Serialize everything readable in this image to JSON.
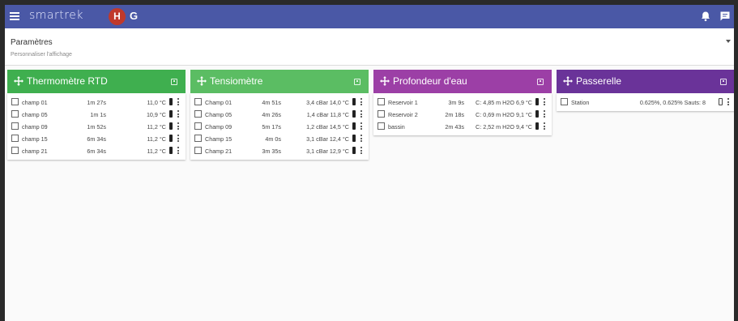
{
  "app": {
    "brand": "smartrek",
    "avatar_initial": "H",
    "avatar_letter": "G"
  },
  "params": {
    "title": "Paramètres",
    "subtitle": "Personnaliser l'affichage"
  },
  "colors": {
    "topbar": "#4a58a6",
    "avatar": "#c0392b",
    "thermo": "#3faf4f",
    "tensio": "#5bbd63",
    "profondeur": "#9c3fa6",
    "passerelle": "#6a3399"
  },
  "panels": [
    {
      "title": "Thermomètre RTD",
      "rows": [
        {
          "name": "champ 01",
          "time": "1m 27s",
          "value": "11,0 °C"
        },
        {
          "name": "champ 05",
          "time": "1m 1s",
          "value": "10,9 °C"
        },
        {
          "name": "champ 09",
          "time": "1m 52s",
          "value": "11,2 °C"
        },
        {
          "name": "champ 15",
          "time": "6m 34s",
          "value": "11,2 °C"
        },
        {
          "name": "champ 21",
          "time": "6m 34s",
          "value": "11,2 °C"
        }
      ]
    },
    {
      "title": "Tensiomètre",
      "rows": [
        {
          "name": "Champ 01",
          "time": "4m 51s",
          "value": "3,4 cBar 14,0 °C"
        },
        {
          "name": "Champ 05",
          "time": "4m 26s",
          "value": "1,4 cBar 11,8 °C"
        },
        {
          "name": "Champ 09",
          "time": "5m 17s",
          "value": "1,2 cBar 14,5 °C"
        },
        {
          "name": "Champ 15",
          "time": "4m 0s",
          "value": "3,1 cBar 12,4 °C"
        },
        {
          "name": "Champ 21",
          "time": "3m 35s",
          "value": "3,1 cBar 12,9 °C"
        }
      ]
    },
    {
      "title": "Profondeur d'eau",
      "rows": [
        {
          "name": "Reservoir 1",
          "time": "3m 9s",
          "value": "C: 4,85 m H2O 6,9 °C"
        },
        {
          "name": "Reservoir 2",
          "time": "2m 18s",
          "value": "C: 0,69 m H2O 9,1 °C"
        },
        {
          "name": "bassin",
          "time": "2m 43s",
          "value": "C: 2,52 m H2O 9,4 °C"
        }
      ]
    },
    {
      "title": "Passerelle",
      "rows": [
        {
          "name": "Station",
          "time": "",
          "value": "0.625%, 0.625% Sauts: 8"
        }
      ]
    }
  ]
}
